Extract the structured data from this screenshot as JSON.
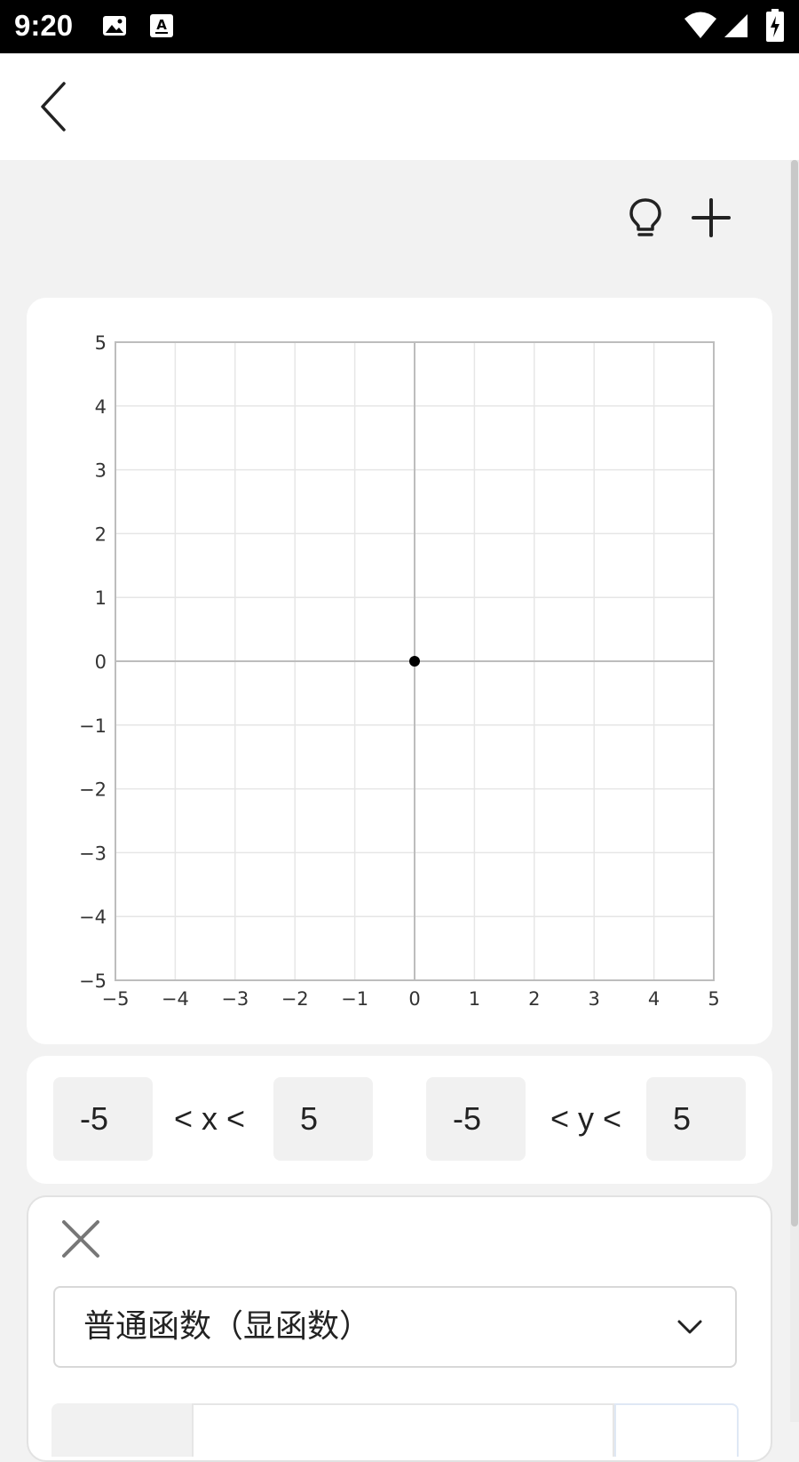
{
  "status_bar": {
    "time": "9:20",
    "icons": [
      "image-icon",
      "text-recognition-icon",
      "wifi-icon",
      "signal-icon",
      "battery-charging-icon"
    ]
  },
  "header": {
    "back_icon": "chevron-left-icon"
  },
  "toolbar": {
    "hint_icon": "lightbulb-icon",
    "add_icon": "plus-icon"
  },
  "chart_data": {
    "type": "scatter",
    "x_ticks": [
      "−5",
      "−4",
      "−3",
      "−2",
      "−1",
      "0",
      "1",
      "2",
      "3",
      "4",
      "5"
    ],
    "y_ticks": [
      "5",
      "4",
      "3",
      "2",
      "1",
      "0",
      "−1",
      "−2",
      "−3",
      "−4",
      "−5"
    ],
    "xlim": [
      -5,
      5
    ],
    "ylim": [
      -5,
      5
    ],
    "grid": true,
    "points": [
      {
        "x": 0,
        "y": 0
      }
    ],
    "point_color": "#000000",
    "grid_color": "#e6e6e6",
    "axis_color": "#bdbdbd"
  },
  "range": {
    "x_min": "-5",
    "x_label": "< x <",
    "x_max": "5",
    "y_min": "-5",
    "y_label": "< y <",
    "y_max": "5"
  },
  "function_card": {
    "close_icon": "close-icon",
    "type_selected": "普通函数（显函数）",
    "dropdown_icon": "chevron-down-icon"
  }
}
